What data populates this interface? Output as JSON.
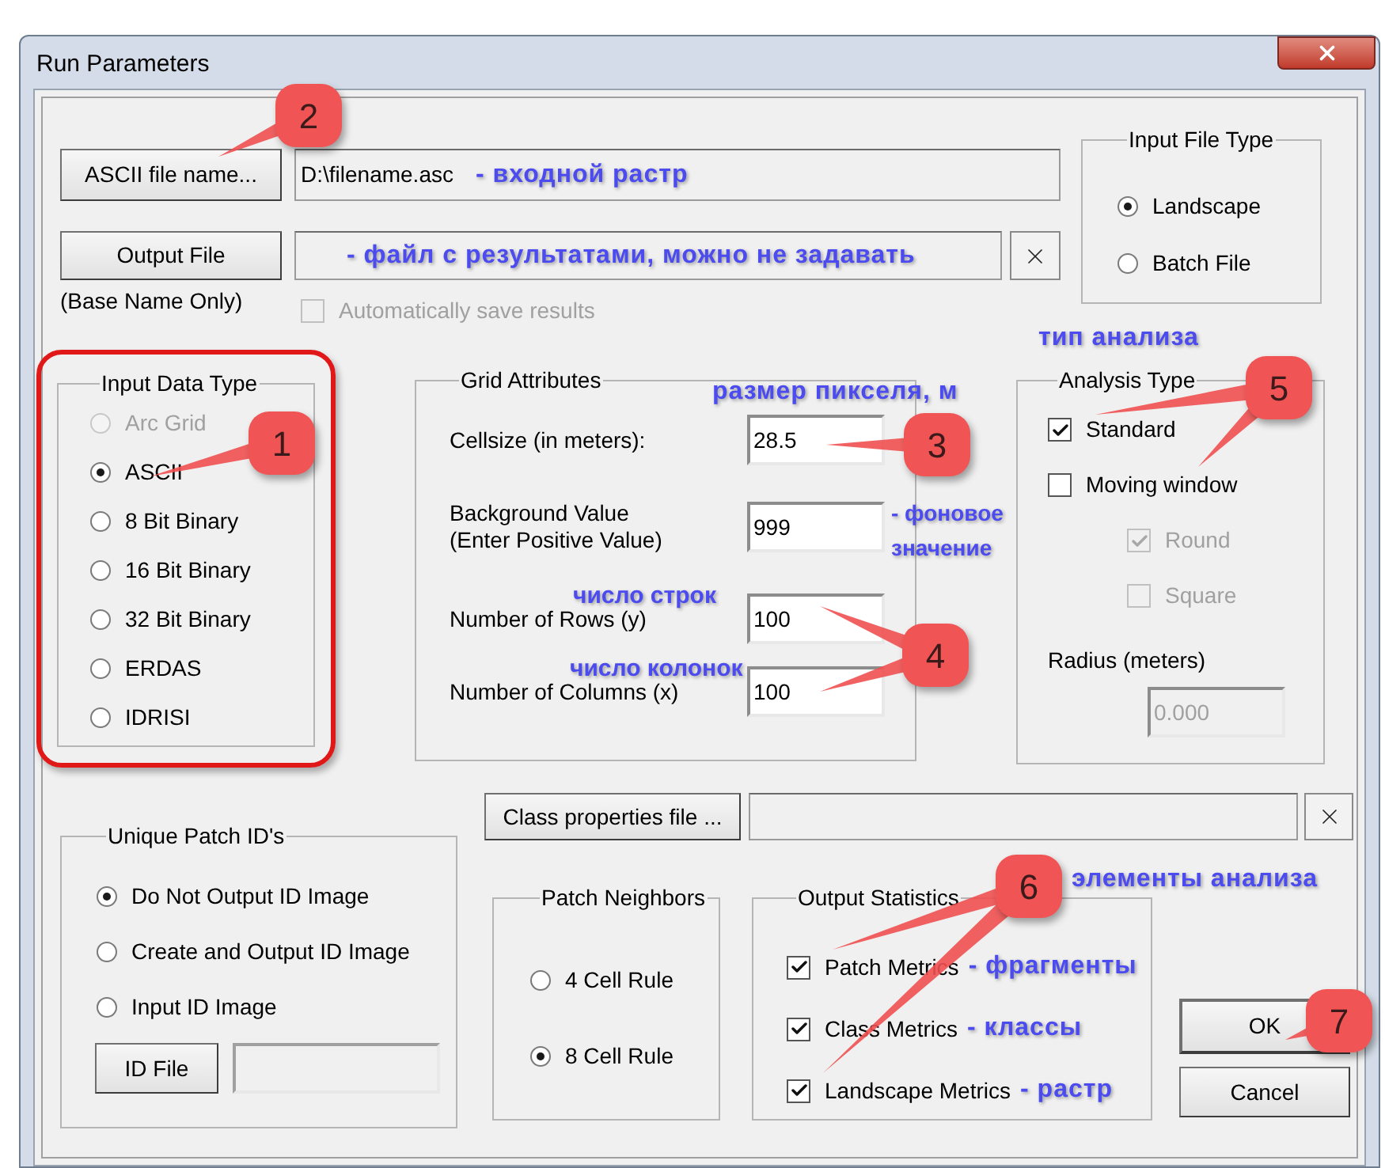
{
  "window": {
    "title": "Run Parameters"
  },
  "ascii_file": {
    "button": "ASCII file name...",
    "value": "D:\\filename.asc",
    "note": "- входной растр"
  },
  "output_file": {
    "button": "Output File",
    "note": "- файл с результатами, можно не задавать",
    "hint": "(Base Name Only)"
  },
  "auto_save": {
    "label": "Automatically save results",
    "checked": false,
    "disabled": true
  },
  "input_file_type": {
    "title": "Input File Type",
    "options": [
      {
        "label": "Landscape",
        "selected": true
      },
      {
        "label": "Batch File",
        "selected": false
      }
    ]
  },
  "input_data_type": {
    "title": "Input Data Type",
    "highlighted": true,
    "options": [
      {
        "label": "Arc Grid",
        "selected": false,
        "disabled": true
      },
      {
        "label": "ASCII",
        "selected": true,
        "disabled": false
      },
      {
        "label": "8 Bit Binary",
        "selected": false,
        "disabled": false
      },
      {
        "label": "16 Bit Binary",
        "selected": false,
        "disabled": false
      },
      {
        "label": "32 Bit Binary",
        "selected": false,
        "disabled": false
      },
      {
        "label": "ERDAS",
        "selected": false,
        "disabled": false
      },
      {
        "label": "IDRISI",
        "selected": false,
        "disabled": false
      }
    ]
  },
  "grid_attributes": {
    "title": "Grid Attributes",
    "fields": [
      {
        "label": "Cellsize (in meters):",
        "value": "28.5"
      },
      {
        "label": "Background Value",
        "sublabel": "(Enter Positive Value)",
        "value": "999",
        "note": "- фоновое значение"
      },
      {
        "label": "Number of Rows (y)",
        "value": "100"
      },
      {
        "label": "Number of Columns (x)",
        "value": "100"
      }
    ]
  },
  "analysis_type": {
    "title": "Analysis Type",
    "options": [
      {
        "label": "Standard",
        "checked": true,
        "disabled": false
      },
      {
        "label": "Moving window",
        "checked": false,
        "disabled": false,
        "children": [
          {
            "label": "Round",
            "checked": true,
            "disabled": true
          },
          {
            "label": "Square",
            "checked": false,
            "disabled": true
          }
        ]
      }
    ],
    "radius": {
      "label": "Radius (meters)",
      "value": "0.000",
      "disabled": true
    }
  },
  "unique_patch_ids": {
    "title": "Unique Patch ID's",
    "options": [
      {
        "label": "Do Not Output ID Image",
        "selected": true
      },
      {
        "label": "Create and Output ID Image",
        "selected": false
      },
      {
        "label": "Input ID Image",
        "selected": false
      }
    ],
    "id_file_button": "ID File"
  },
  "class_properties": {
    "button": "Class properties file ..."
  },
  "patch_neighbors": {
    "title": "Patch Neighbors",
    "options": [
      {
        "label": "4 Cell Rule",
        "selected": false
      },
      {
        "label": "8 Cell Rule",
        "selected": true
      }
    ]
  },
  "output_statistics": {
    "title": "Output Statistics",
    "options": [
      {
        "label": "Patch Metrics",
        "checked": true,
        "note": "- фрагменты"
      },
      {
        "label": "Class Metrics",
        "checked": true,
        "note": "- классы"
      },
      {
        "label": "Landscape Metrics",
        "checked": true,
        "note": "- растр"
      }
    ]
  },
  "buttons": [
    "OK",
    "Cancel"
  ],
  "annotations": {
    "callouts": [
      "1",
      "2",
      "3",
      "4",
      "5",
      "6",
      "7"
    ],
    "notes": [
      "тип анализа",
      "размер пикселя, м",
      "число строк",
      "число колонок",
      "элементы анализа"
    ]
  }
}
